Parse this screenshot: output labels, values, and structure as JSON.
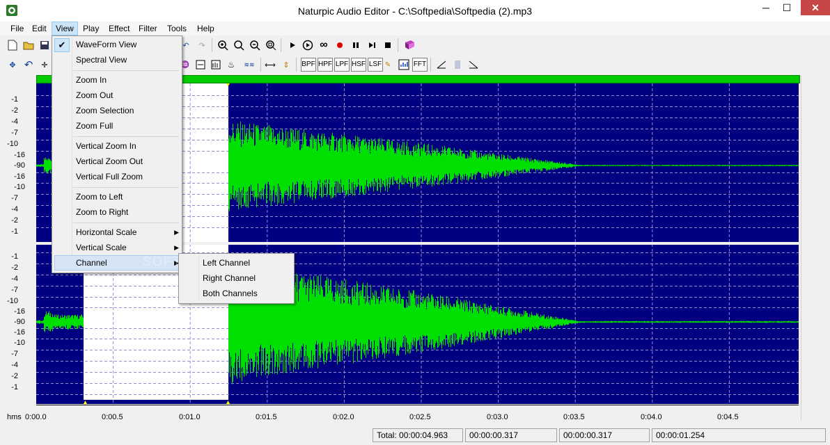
{
  "window": {
    "title": "Naturpic Audio Editor - C:\\Softpedia\\Softpedia (2).mp3",
    "minimize": "─",
    "maximize": "☐",
    "close": "✕"
  },
  "menubar": [
    "File",
    "Edit",
    "View",
    "Play",
    "Effect",
    "Filter",
    "Tools",
    "Help"
  ],
  "toolbar2_text_buttons": [
    "BPF",
    "HPF",
    "LPF",
    "HSF",
    "LSF",
    "FFT"
  ],
  "view_menu": {
    "items": [
      {
        "label": "WaveForm View",
        "checked": true
      },
      {
        "label": "Spectral View"
      },
      {
        "label": "Zoom In"
      },
      {
        "label": "Zoom Out"
      },
      {
        "label": "Zoom Selection"
      },
      {
        "label": "Zoom Full"
      },
      {
        "label": "Vertical Zoom In"
      },
      {
        "label": "Vertical Zoom Out"
      },
      {
        "label": "Vertical Full Zoom"
      },
      {
        "label": "Zoom to Left"
      },
      {
        "label": "Zoom to Right"
      },
      {
        "label": "Horizontal Scale",
        "submenu": true
      },
      {
        "label": "Vertical Scale",
        "submenu": true
      },
      {
        "label": "Channel",
        "submenu": true,
        "highlighted": true
      }
    ],
    "check_mark": "✔",
    "submenu_arrow": "▶"
  },
  "channel_menu": [
    "Left Channel",
    "Right Channel",
    "Both Channels"
  ],
  "y_labels": [
    "-1",
    "-2",
    "-4",
    "-7",
    "-10",
    "-16",
    "-90",
    "-16",
    "-10",
    "-7",
    "-4",
    "-2",
    "-1"
  ],
  "x_axis": {
    "unit_label": "hms",
    "ticks": [
      "0:00.0",
      "0:00.5",
      "0:01.0",
      "0:01.5",
      "0:02.0",
      "0:02.5",
      "0:03.0",
      "0:03.5",
      "0:04.0",
      "0:04.5"
    ]
  },
  "status": {
    "total": "Total: 00:00:04.963",
    "sel_start": "00:00:00.317",
    "sel_end": "00:00:00.317",
    "sel_length": "00:00:01.254"
  },
  "watermark": "SOFTPEDIA",
  "colors": {
    "wave": "#00e000",
    "track_bg": "#000080",
    "selection": "#ffffff"
  }
}
